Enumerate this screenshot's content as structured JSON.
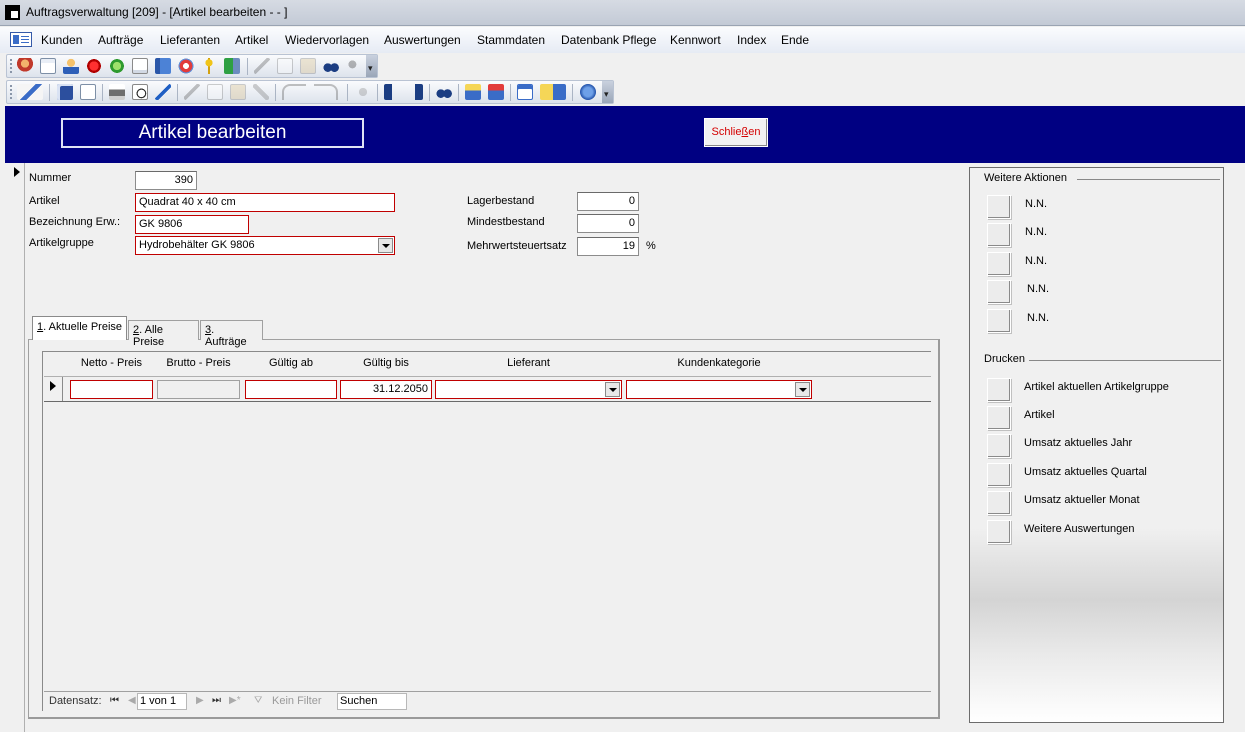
{
  "window": {
    "title": "Auftragsverwaltung [209] - [Artikel bearbeiten -  - ]"
  },
  "menu": {
    "items": [
      "Kunden",
      "Aufträge",
      "Lieferanten",
      "Artikel",
      "Wiedervorlagen",
      "Auswertungen",
      "Stammdaten",
      "Datenbank Pflege",
      "Kennwort",
      "Index",
      "Ende"
    ]
  },
  "toolbar1": {
    "icons": [
      "person-icon",
      "document-icon",
      "user-icon",
      "red-gear-icon",
      "green-refresh-icon",
      "list-icon",
      "book-icon",
      "medical-cross-icon",
      "key-icon",
      "exit-icon",
      "cut-icon",
      "copy-icon",
      "paste-icon",
      "find-icon",
      "find-replace-icon"
    ]
  },
  "toolbar2": {
    "icons": [
      "design-view-icon",
      "save-icon",
      "print-preview-icon",
      "print-icon",
      "search-preview-icon",
      "spellcheck-icon",
      "cut-icon",
      "copy-icon",
      "paste-icon",
      "format-painter-icon",
      "undo-icon",
      "redo-icon",
      "hyperlink-icon",
      "sort-ascending-icon",
      "sort-descending-icon",
      "find-icon",
      "new-record-icon",
      "delete-record-icon",
      "database-window-icon",
      "new-object-icon",
      "help-icon"
    ]
  },
  "header": {
    "title": "Artikel bearbeiten",
    "close_label": "Schließen",
    "close_accesskey_label": "Schlie",
    "close_underlined": "ß",
    "close_rest": "en"
  },
  "form": {
    "nummer_label": "Nummer",
    "nummer_value": "390",
    "artikel_label": "Artikel",
    "artikel_value": "Quadrat 40 x 40 cm",
    "bezeichnung_label": "Bezeichnung Erw.:",
    "bezeichnung_value": "GK 9806",
    "artikelgruppe_label": "Artikelgruppe",
    "artikelgruppe_value": "Hydrobehälter GK 9806",
    "lagerbestand_label": "Lagerbestand",
    "lagerbestand_value": "0",
    "mindestbestand_label": "Mindestbestand",
    "mindestbestand_value": "0",
    "mwst_label": "Mehrwertsteuertsatz",
    "mwst_value": "19",
    "mwst_unit": "%"
  },
  "tabs": [
    {
      "key": "1",
      "label": ". Aktuelle Preise"
    },
    {
      "key": "2",
      "label": ". Alle Preise"
    },
    {
      "key": "3",
      "label": ". Aufträge"
    }
  ],
  "grid": {
    "columns": [
      "Netto - Preis",
      "Brutto - Preis",
      "Gültig ab",
      "Gültig bis",
      "Lieferant",
      "Kundenkategorie"
    ],
    "row": {
      "netto": "",
      "brutto": "",
      "gueltig_ab": "",
      "gueltig_bis": "31.12.2050",
      "lieferant": "",
      "kundenkategorie": ""
    }
  },
  "navbar": {
    "record_label": "Datensatz:",
    "record_value": "1 von 1",
    "filter_label": "Kein Filter",
    "search_label": "Suchen"
  },
  "rightpanel": {
    "actions_title": "Weitere Aktionen",
    "actions": [
      "N.N.",
      "N.N.",
      "N.N.",
      "N.N.",
      "N.N."
    ],
    "print_title": "Drucken",
    "print_items": [
      "Artikel aktuellen Artikelgruppe",
      "Artikel",
      "Umsatz aktuelles Jahr",
      "Umsatz aktuelles Quartal",
      "Umsatz aktueller Monat",
      "Weitere Auswertungen"
    ]
  }
}
